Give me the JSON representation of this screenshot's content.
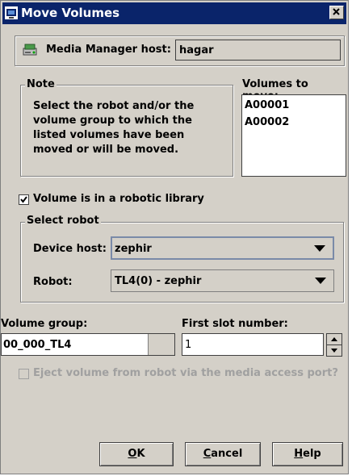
{
  "window": {
    "title": "Move Volumes"
  },
  "host": {
    "label": "Media Manager host:",
    "value": "hagar"
  },
  "note": {
    "legend": "Note",
    "lines": [
      "Select the robot and/or the",
      "volume group to which the",
      "listed volumes have been",
      "moved or will be moved."
    ]
  },
  "volumes": {
    "label": "Volumes to move:",
    "items": [
      "A00001",
      "A00002"
    ]
  },
  "robotic": {
    "label": "Volume is in a robotic library",
    "checked": true
  },
  "select_robot": {
    "legend": "Select robot",
    "device_host_label": "Device host:",
    "device_host_value": "zephir",
    "robot_label": "Robot:",
    "robot_value": "TL4(0) - zephir"
  },
  "volume_group": {
    "label": "Volume group:",
    "value": "00_000_TL4"
  },
  "first_slot": {
    "label": "First slot number:",
    "value": "1"
  },
  "eject": {
    "label": "Eject volume from robot via the media access port?",
    "checked": false,
    "enabled": false
  },
  "buttons": {
    "ok": {
      "mnemonic": "O",
      "rest": "K"
    },
    "cancel": {
      "mnemonic": "C",
      "rest": "ancel"
    },
    "help": {
      "mnemonic": "H",
      "rest": "elp"
    }
  },
  "colors": {
    "titlebar": "#0a246a",
    "face": "#d4d0c8",
    "disabled_text": "#a0a0a0"
  }
}
